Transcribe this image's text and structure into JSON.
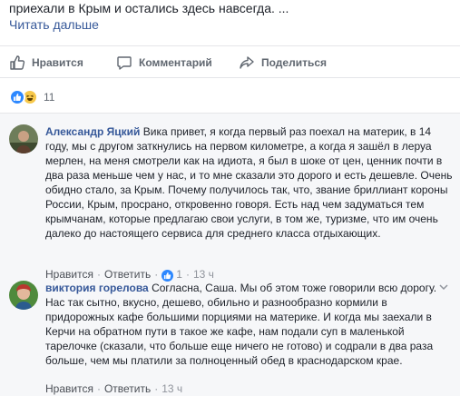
{
  "post": {
    "snippet": "приехали в Крым и остались здесь навсегда. ...",
    "read_more": "Читать дальше"
  },
  "actions": {
    "like": "Нравится",
    "comment": "Комментарий",
    "share": "Поделиться"
  },
  "reactions": {
    "count": "11"
  },
  "comments": [
    {
      "author": "Александр Яцкий",
      "text": "Вика привет, я когда первый раз поехал на материк, в 14 году, мы с другом заткнулись на первом километре, а когда я зашёл в леруа мерлен, на меня смотрели как на идиота, я был в шоке от цен, ценник почти в два раза меньше чем у нас, и то мне сказали это дорого и есть дешевле. Очень обидно стало, за Крым. Почему получилось так, что, звание бриллиант короны России, Крым, просрано, откровенно говоря. Есть над чем задуматься тем крымчанам, которые предлагаю свои услуги, в том же, туризме, что им очень далеко до настоящего сервиса для среднего класса отдыхающих.",
      "like_label": "Нравится",
      "reply_label": "Ответить",
      "like_count": "1",
      "time": "13 ч"
    },
    {
      "author": "виктория горелова",
      "text": "Согласна, Саша. Мы об этом тоже говорили всю дорогу. Нас так сытно, вкусно, дешево, обильно и разнообразно кормили в придорожных кафе большими порциями на материке. И когда мы заехали в Керчи на обратном пути в такое же кафе, нам подали суп в маленькой тарелочке (сказали, что больше еще ничего не готово) и содрали в два раза больше, чем мы платили за полноценный обед в краснодарском крае.",
      "like_label": "Нравится",
      "reply_label": "Ответить",
      "time": "13 ч"
    }
  ]
}
